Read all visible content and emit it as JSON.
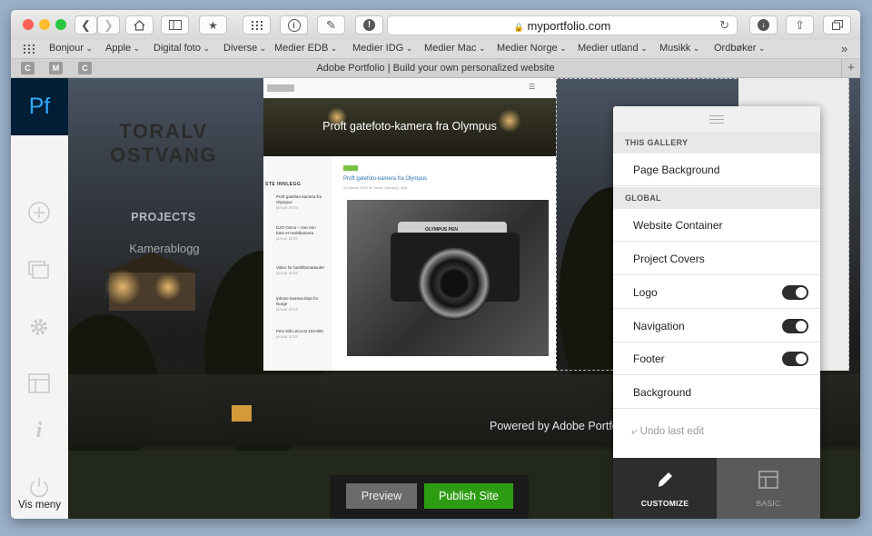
{
  "browser": {
    "url": "myportfolio.com",
    "tab_title": "Adobe Portfolio | Build your own personalized website",
    "pinned_tabs": [
      "C",
      "M",
      "C"
    ],
    "bookmarks": [
      "Bonjour",
      "Apple",
      "Digital foto",
      "Diverse",
      "Medier EDB",
      "Medier IDG",
      "Medier Mac",
      "Medier Norge",
      "Medier utland",
      "Musikk",
      "Ordbøker"
    ],
    "overflow": "»"
  },
  "sidebar": {
    "logo": "Pf",
    "menu_label": "Vis meny"
  },
  "site": {
    "brand_line1": "TORALV",
    "brand_line2": "OSTVANG",
    "nav_projects": "PROJECTS",
    "nav_kamerablogg": "Kamerablogg",
    "powered_by": "Powered by Adobe Portfol"
  },
  "embedded": {
    "header_title": "Proft gatefoto-kamera fra Olympus",
    "sidebar_heading": "STE INNLEGG",
    "posts": [
      {
        "title": "Proft gatefoto-kamera fra Olympus",
        "date": "januar 2019"
      },
      {
        "title": "DJO Osmo – mer enn bare et mobilkamera",
        "date": "januar 2019"
      },
      {
        "title": "Video for bedriftsmarkedet",
        "date": "januar 2019"
      },
      {
        "title": "Iphone kamera klart for Norge",
        "date": "januar 2019"
      },
      {
        "title": "Fem stilt Leica M 223-900",
        "date": "januar 2019"
      }
    ],
    "post_title": "Proft gatefoto-kamera fra Olympus",
    "post_meta": "24 januar 2019 av Toralv Ostvang i Nytt",
    "camera_brand": "OLYMPUS PEN"
  },
  "publish_bar": {
    "preview": "Preview",
    "publish": "Publish Site"
  },
  "panel": {
    "section_gallery": "THIS GALLERY",
    "page_background": "Page Background",
    "section_global": "GLOBAL",
    "items": [
      {
        "label": "Website Container",
        "toggle": null
      },
      {
        "label": "Project Covers",
        "toggle": null
      },
      {
        "label": "Logo",
        "toggle": true
      },
      {
        "label": "Navigation",
        "toggle": true
      },
      {
        "label": "Footer",
        "toggle": true
      },
      {
        "label": "Background",
        "toggle": null
      }
    ],
    "undo": "Undo last edit",
    "tab_customize": "CUSTOMIZE",
    "tab_basic": "BASIC",
    "active_tab": "CUSTOMIZE"
  },
  "colors": {
    "publish_green": "#2e9c13",
    "pf_blue": "#31a8ff",
    "pf_navy": "#001e36"
  }
}
